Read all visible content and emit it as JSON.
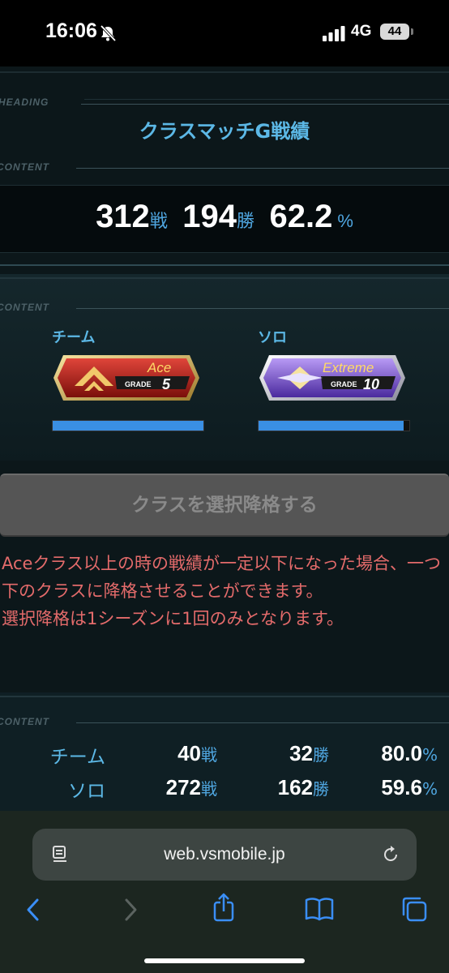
{
  "status": {
    "time": "16:06",
    "network": "4G",
    "battery": "44"
  },
  "sections": {
    "heading_tag": "HEADING",
    "content_tag": "CONTENT"
  },
  "header": {
    "title": "クラスマッチG戦績"
  },
  "record": {
    "battles": "312",
    "battles_unit": "戦",
    "wins": "194",
    "wins_unit": "勝",
    "rate": "62.2",
    "rate_unit": "%"
  },
  "classes": {
    "team": {
      "label": "チーム",
      "rank": "Ace",
      "grade_label": "GRADE",
      "grade": "5",
      "progress": 1.0,
      "color": "#c1281f"
    },
    "solo": {
      "label": "ソロ",
      "rank": "Extreme",
      "grade_label": "GRADE",
      "grade": "10",
      "progress": 0.96,
      "color": "#7a4fd6"
    }
  },
  "demote_button": {
    "label": "クラスを選択降格する"
  },
  "notice": {
    "line1": "Aceクラス以上の時の戦績が一定以下になった場合、一つ下のクラスに降格させることができます。",
    "line2": "選択降格は1シーズンに1回のみとなります。"
  },
  "breakdown": [
    {
      "label": "チーム",
      "battles": "40",
      "wins": "32",
      "rate": "80.0"
    },
    {
      "label": "ソロ",
      "battles": "272",
      "wins": "162",
      "rate": "59.6"
    }
  ],
  "units": {
    "battle": "戦",
    "win": "勝",
    "percent": "%"
  },
  "browser": {
    "url": "web.vsmobile.jp"
  },
  "icons": [
    "bell-slash-icon",
    "signal-icon",
    "reader-icon",
    "reload-icon",
    "back-icon",
    "forward-icon",
    "share-icon",
    "bookmarks-icon",
    "tabs-icon"
  ]
}
